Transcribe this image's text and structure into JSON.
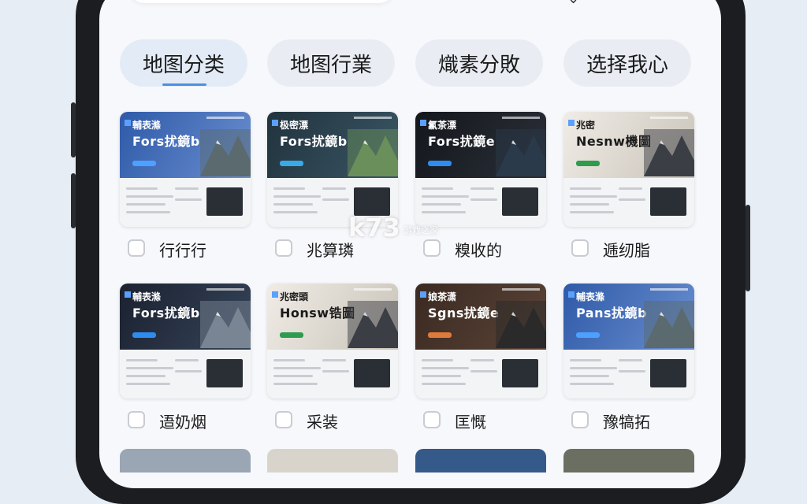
{
  "tabs": [
    {
      "label": "地图分类",
      "active": true
    },
    {
      "label": "地图行業",
      "active": false
    },
    {
      "label": "熾素分敗",
      "active": false
    },
    {
      "label": "选择我心",
      "active": false
    }
  ],
  "cards": [
    {
      "line1": "輔表滌",
      "line2": "Fors扰鏡b",
      "label": "行行行",
      "theme": "blue"
    },
    {
      "line1": "极密漂",
      "line2": "Fors扰鏡b",
      "label": "兆算璘",
      "theme": "teal"
    },
    {
      "line1": "氱茶漂",
      "line2": "Fors扰鏡e",
      "label": "糗收的",
      "theme": "dark"
    },
    {
      "line1": "兆密",
      "line2": "Nesnw機圖",
      "label": "逓纫脂",
      "theme": "light"
    },
    {
      "line1": "輔表滌",
      "line2": "Fors扰鏡b",
      "label": "逜奶烟",
      "theme": "navy"
    },
    {
      "line1": "兆密頭",
      "line2": "Honsw锆圖",
      "label": "采装",
      "theme": "light"
    },
    {
      "line1": "娘茶潇",
      "line2": "Sgns扰鏡e",
      "label": "匡慨",
      "theme": "brown"
    },
    {
      "line1": "輔表滌",
      "line2": "Pans扰鏡b",
      "label": "豫犒拓",
      "theme": "blue"
    }
  ],
  "watermark": {
    "big": "k73",
    "small": "游戏之家"
  },
  "colors": {
    "accent": "#4a90e2",
    "background": "#f6f8fb"
  }
}
